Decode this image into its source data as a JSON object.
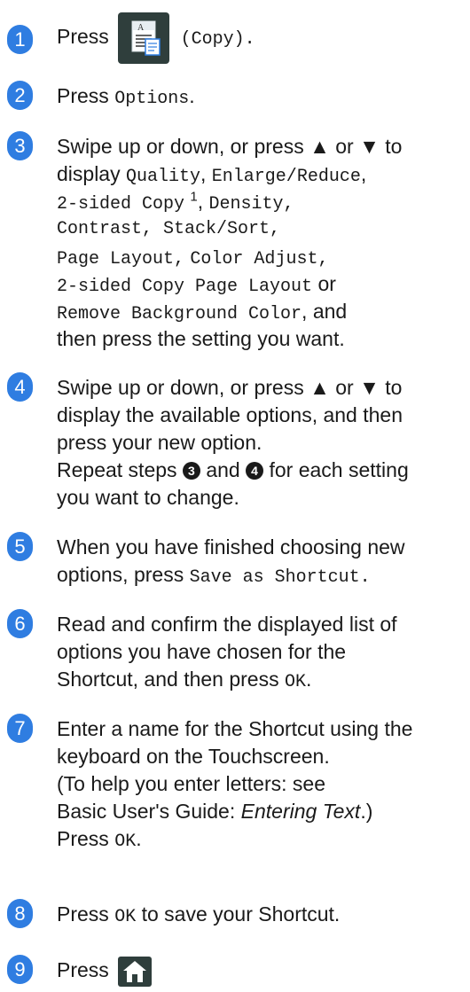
{
  "steps": [
    {
      "n": "1",
      "press": "Press",
      "after": "(Copy)."
    },
    {
      "n": "2",
      "press": "Press",
      "options": "Options",
      "end": "."
    },
    {
      "n": "3",
      "l1": "Swipe up or down, or press ▲ or ▼ to",
      "l2a": "display",
      "l2b": "Quality",
      "l2c": ",",
      "l2d": "Enlarge/Reduce",
      "l3a": "2-sided Copy",
      "l3sup": "1",
      "l3b": ",",
      "l3c": "Density,",
      "l4": "Contrast, Stack/Sort,",
      "l5a": "Page Layout,",
      "l5b": "Color Adjust,",
      "l6a": "2-sided Copy Page Layout",
      "l6b": "or",
      "l7a": "Remove Background Color",
      "l7b": ", and",
      "l8": "then press the setting you want."
    },
    {
      "n": "4",
      "l1": "Swipe up or down, or press ▲ or ▼ to",
      "l2": "display the available options, and then",
      "l3": "press your new option.",
      "l4a": "Repeat steps",
      "c3": "3",
      "l4b": "and",
      "c4": "4",
      "l4c": "for each setting",
      "l5": "you want to change."
    },
    {
      "n": "5",
      "l1": "When you have finished choosing new",
      "l2a": "options, press",
      "l2b": "Save as Shortcut."
    },
    {
      "n": "6",
      "l1": "Read and confirm the displayed list of",
      "l2": "options you have chosen for the",
      "l3a": "Shortcut, and then press",
      "l3b": "OK",
      "l3c": "."
    },
    {
      "n": "7",
      "l1": "Enter a name for the Shortcut using the",
      "l2": "keyboard on the Touchscreen.",
      "l3": "(To help you enter letters: see",
      "l4a": "Basic User's Guide:",
      "l4b": "Entering Text",
      "l4c": ".)",
      "l5a": "Press",
      "l5b": "OK",
      "l5c": "."
    },
    {
      "n": "8",
      "l1a": "Press",
      "l1b": "OK",
      "l1c": "to save your Shortcut."
    },
    {
      "n": "9",
      "l1": "Press"
    }
  ],
  "icons": {
    "copy": "copy-icon",
    "home": "home-icon"
  },
  "colors": {
    "accent": "#2f7de1",
    "button": "#2f3e3c"
  }
}
